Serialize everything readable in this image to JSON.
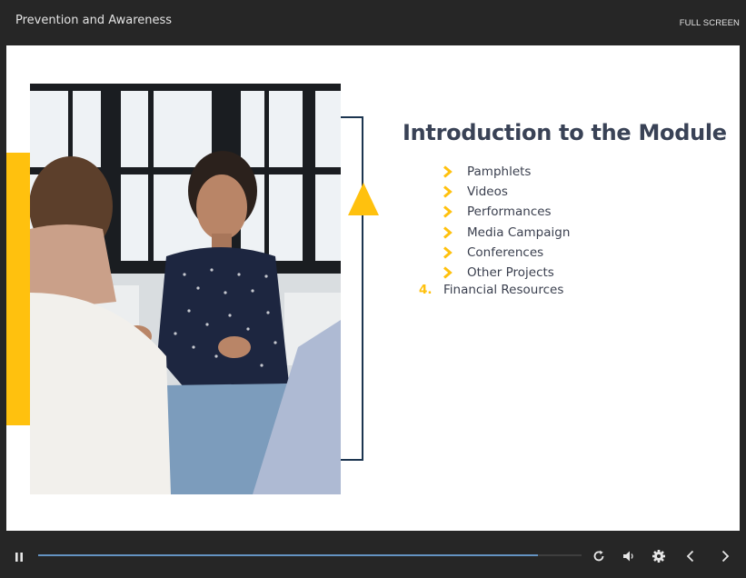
{
  "header": {
    "title": "Prevention and Awareness",
    "fullscreen_label": "FULL SCREEN"
  },
  "slide": {
    "heading": "Introduction to the Module",
    "bullets": [
      "Pamphlets",
      "Videos",
      "Performances",
      "Media Campaign",
      "Conferences",
      "Other Projects"
    ],
    "numbered_item": {
      "number": "4.",
      "label": "Financial Resources"
    },
    "accent_color": "#ffc10e",
    "bracket_color": "#1c3550",
    "image": "group-therapy-session-photo"
  },
  "controls": {
    "progress": 0.92,
    "icons": [
      "pause-icon",
      "replay-icon",
      "volume-icon",
      "settings-icon",
      "previous-icon",
      "next-icon"
    ]
  }
}
